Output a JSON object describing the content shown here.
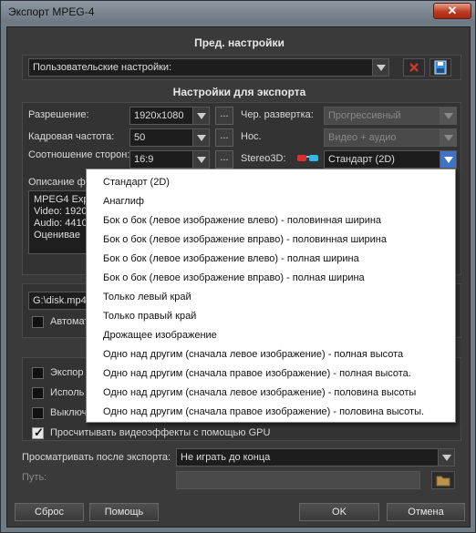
{
  "window": {
    "title": "Экспорт MPEG-4",
    "close_label": "✕"
  },
  "presets": {
    "section_title": "Пред. настройки",
    "combo_value": "Пользовательские настройки:"
  },
  "export": {
    "section_title": "Настройки для экспорта",
    "resolution_label": "Разрешение:",
    "resolution_value": "1920x1080",
    "framerate_label": "Кадровая частота:",
    "framerate_value": "50",
    "aspect_label": "Соотношение сторон:",
    "aspect_value": "16:9",
    "more_label": "...",
    "interlace_label": "Чер. развертка:",
    "interlace_value": "Прогрессивный",
    "carrier_label": "Нос.",
    "carrier_value": "Видео + аудио",
    "stereo_label": "Stereo3D:",
    "stereo_value": "Стандарт (2D)",
    "description_label": "Описание ф",
    "description_lines": [
      "MPEG4 Exp",
      "Video: 1920",
      "Audio: 4410",
      "Оценивае"
    ]
  },
  "output": {
    "path_value": "G:\\disk.mp4",
    "auto_label": "Автомат"
  },
  "options": {
    "items": [
      {
        "label": "Экспор",
        "checked": false
      },
      {
        "label": "Исполь",
        "checked": false
      },
      {
        "label": "Выключ",
        "checked": false
      },
      {
        "label": "Просчитывать видеоэффекты с помощью GPU",
        "checked": true
      }
    ],
    "playback_label": "Просматривать после экспорта:",
    "playback_value": "Не играть до конца",
    "path_label": "Путь:"
  },
  "buttons": {
    "reset": "Сброс",
    "help": "Помощь",
    "ok": "OK",
    "cancel": "Отмена"
  },
  "stereo_dropdown": {
    "options": [
      "Стандарт (2D)",
      "Анаглиф",
      "Бок о бок (левое изображение влево) - половинная ширина",
      "Бок о бок (левое изображение вправо) - половинная ширина",
      "Бок о бок (левое изображение влево) - полная ширина",
      "Бок о бок (левое изображение вправо) - полная ширина",
      "Только левый край",
      "Только правый край",
      "Дрожащее изображение",
      "Одно над другим (сначала левое изображение) - полная высота",
      "Одно над другим (сначала правое изображение) - полная высота.",
      "Одно над другим (сначала левое изображение) - половина высоты",
      "Одно над другим (сначала правое изображение) - половина высоты."
    ]
  },
  "colors": {
    "accent": "#3f73c5",
    "delete_red": "#c83a2a",
    "save_blue": "#3a8fd8"
  }
}
